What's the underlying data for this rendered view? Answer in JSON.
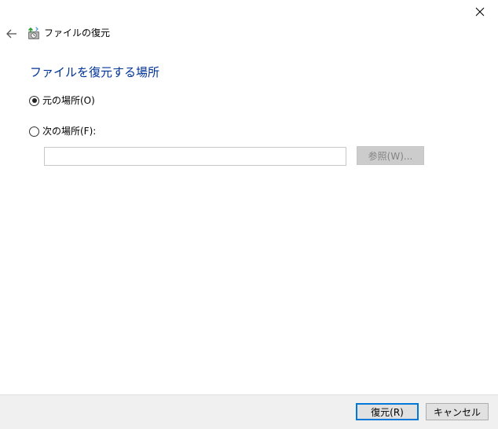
{
  "window": {
    "title": "ファイルの復元"
  },
  "main": {
    "heading": "ファイルを復元する場所",
    "options": [
      {
        "label": "元の場所(O)",
        "selected": true
      },
      {
        "label": "次の場所(F):",
        "selected": false
      }
    ],
    "path_input": {
      "value": "",
      "placeholder": ""
    },
    "browse_label": "参照(W)..."
  },
  "footer": {
    "restore_label": "復元(R)",
    "cancel_label": "キャンセル"
  },
  "colors": {
    "heading": "#003399",
    "default_button_border": "#0078d7",
    "footer_background": "#f0f0f0",
    "disabled_button_background": "#cccccc"
  },
  "icons": {
    "close": "close-icon",
    "back": "back-arrow-icon",
    "app": "restore-files-icon"
  }
}
